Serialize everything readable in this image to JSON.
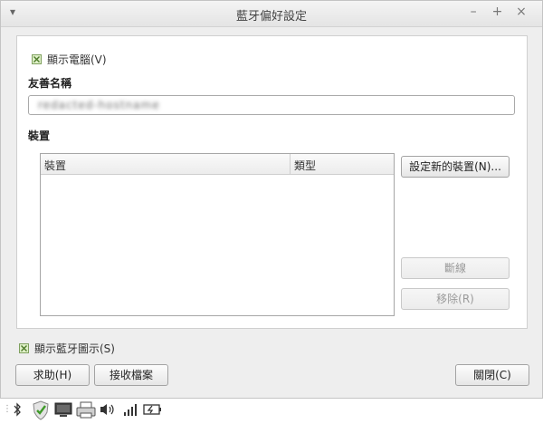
{
  "window": {
    "title": "藍牙偏好設定",
    "menu_glyph": "▾",
    "min_glyph": "–",
    "max_glyph": "+",
    "close_glyph": "×"
  },
  "show_computer": {
    "label": "顯示電腦(V)",
    "checked": true
  },
  "friendly_name": {
    "label": "友善名稱",
    "value": "redacted-hostname"
  },
  "devices": {
    "section_label": "裝置",
    "col_device": "裝置",
    "col_type": "類型",
    "rows": []
  },
  "buttons": {
    "setup_new": "設定新的裝置(N)...",
    "disconnect": "斷線",
    "remove": "移除(R)",
    "help": "求助(H)",
    "receive_files": "接收檔案",
    "close": "關閉(C)"
  },
  "show_icon": {
    "label": "顯示藍牙圖示(S)",
    "checked": true
  },
  "taskbar": {
    "handle_icon": "grip-icon",
    "icons": [
      "bluetooth-icon",
      "shield-check-icon",
      "monitor-icon",
      "printer-icon",
      "speaker-icon",
      "signal-icon",
      "battery-icon"
    ]
  },
  "colors": {
    "check_green": "#7fa05e",
    "window_bg": "#eeeeee"
  }
}
